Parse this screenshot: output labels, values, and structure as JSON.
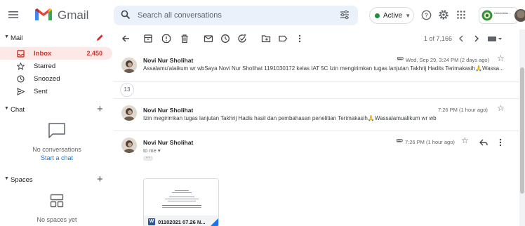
{
  "app": {
    "title": "Gmail",
    "brand_color": "#EA4335"
  },
  "search": {
    "placeholder": "Search all conversations"
  },
  "status": {
    "label": "Active",
    "color": "#1e8e3e"
  },
  "org_badge_text": "Universitas ...",
  "sidebar": {
    "mail_header": "Mail",
    "items": [
      {
        "label": "Inbox",
        "count": "2,450",
        "icon": "inbox-icon",
        "active": true
      },
      {
        "label": "Starred",
        "icon": "star-icon"
      },
      {
        "label": "Snoozed",
        "icon": "clock-icon"
      },
      {
        "label": "Sent",
        "icon": "send-icon"
      }
    ],
    "chat_header": "Chat",
    "chat_empty": "No conversations",
    "chat_start": "Start a chat",
    "spaces_header": "Spaces",
    "spaces_empty": "No spaces yet"
  },
  "toolbar": {
    "pager": "1 of 7,166"
  },
  "thread": {
    "messages": [
      {
        "sender": "Novi Nur Sholihat",
        "snippet": "Assalamu'alaikum wr wbSaya Novi Nur Sholihat 1191030172 kelas IAT 5C Izin mengirimkan tugas lanjutan Takhrij Hadits Terimakasih🙏Wassa...",
        "date": "Wed, Sep 29, 3:24 PM (2 days ago)"
      },
      {
        "sender": "Novi Nur Sholihat",
        "snippet": "Izin megirimkan tugas lanjutan Takhrij Hadis hasil dan pembahasan penelitian Terimakasih🙏Wassalamualikum wr wb",
        "date": "7:26 PM (1 hour ago)"
      },
      {
        "sender": "Novi Nur Sholihat",
        "to": "to me",
        "date": "7:26 PM (1 hour ago)"
      }
    ],
    "collapsed_count": "13",
    "attachment_name": "01102021 07.26 N..."
  }
}
